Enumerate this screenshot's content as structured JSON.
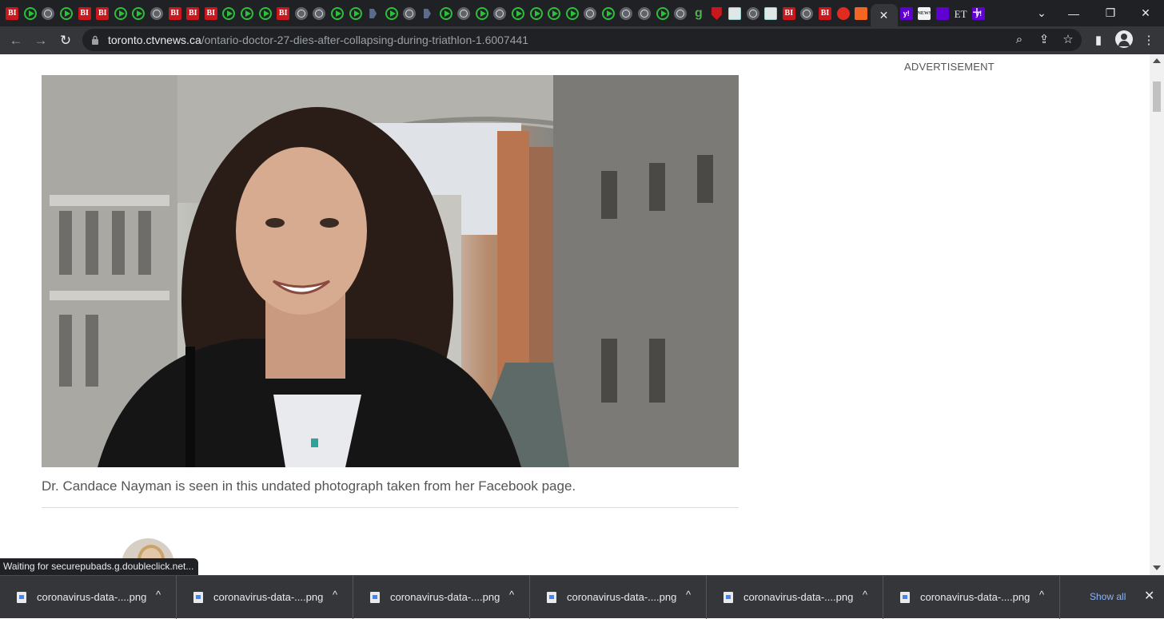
{
  "browser": {
    "tabs": [
      "bi",
      "play",
      "globe",
      "play",
      "bi",
      "bi",
      "play",
      "play",
      "globe",
      "bi",
      "bi",
      "bi",
      "play",
      "play",
      "play",
      "bi",
      "globe",
      "globe",
      "play",
      "play",
      "dark",
      "play",
      "globe",
      "dark",
      "play",
      "globe",
      "play",
      "globe",
      "play",
      "play",
      "play",
      "play",
      "globe",
      "play",
      "globe",
      "globe",
      "play",
      "globe",
      "g",
      "shield",
      "map",
      "globe",
      "map",
      "bi",
      "globe",
      "bi",
      "mic",
      "orange"
    ],
    "tab_badges": {
      "bi": "BI",
      "g": "g"
    },
    "active_tab_close": "✕",
    "trailing_tabs": [
      {
        "type": "yahoo",
        "text": "y!"
      },
      {
        "type": "news",
        "text": "NEWS"
      },
      {
        "type": "purple",
        "text": ""
      },
      {
        "type": "et",
        "text": "ET"
      },
      {
        "type": "yahoo",
        "text": "y!"
      }
    ],
    "new_tab_label": "+",
    "window_controls": {
      "minimize": "—",
      "restore": "❐",
      "close": "✕"
    },
    "tab_search": "⌄",
    "address": {
      "host": "toronto.ctvnews.ca",
      "path": "/ontario-doctor-27-dies-after-collapsing-during-triathlon-1.6007441"
    },
    "nav": {
      "back": "←",
      "forward": "→",
      "reload": "↻"
    },
    "omnibox_icons": {
      "zoom": "⌕",
      "share": "⇪",
      "bookmark": "☆"
    },
    "toolbar_icons": {
      "side_panel": "▮",
      "menu": "⋮"
    }
  },
  "article": {
    "photo_caption": "Dr. Candace Nayman is seen in this undated photograph taken from her Facebook page.",
    "ad_label": "ADVERTISEMENT"
  },
  "status_bar": "Waiting for securepubads.g.doubleclick.net...",
  "downloads": {
    "items": [
      "coronavirus-data-....png",
      "coronavirus-data-....png",
      "coronavirus-data-....png",
      "coronavirus-data-....png",
      "coronavirus-data-....png",
      "coronavirus-data-....png"
    ],
    "caret": "^",
    "show_all": "Show all",
    "close": "✕"
  },
  "colors": {
    "chrome_dark": "#202124",
    "toolbar": "#35363a",
    "link_blue": "#8ab4f8",
    "caption_gray": "#555555"
  }
}
